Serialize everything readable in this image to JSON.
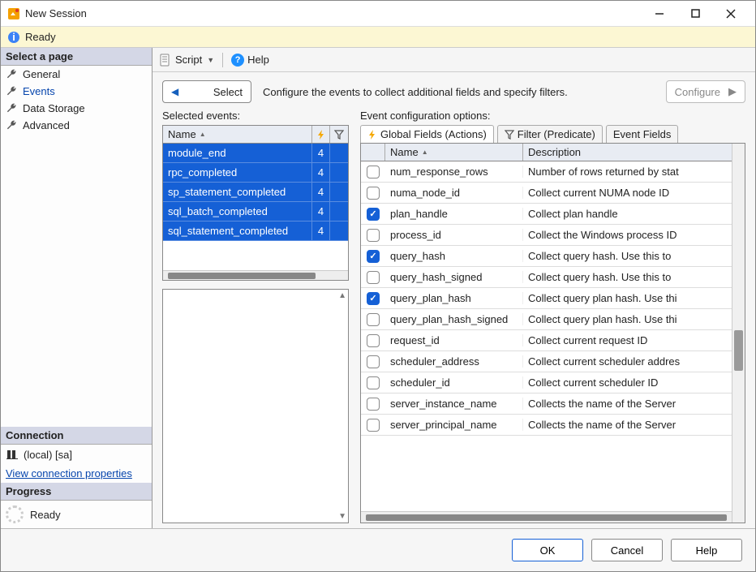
{
  "window": {
    "title": "New Session"
  },
  "ready_strip": {
    "text": "Ready"
  },
  "sidebar": {
    "select_page": "Select a page",
    "items": [
      {
        "label": "General"
      },
      {
        "label": "Events"
      },
      {
        "label": "Data Storage"
      },
      {
        "label": "Advanced"
      }
    ],
    "connection_head": "Connection",
    "connection_label": "(local) [sa]",
    "view_conn": "View connection properties",
    "progress_head": "Progress",
    "progress_status": "Ready"
  },
  "toolbar": {
    "script": "Script",
    "help": "Help"
  },
  "row1": {
    "select_label": "Select",
    "info": "Configure the events to collect additional fields and specify filters.",
    "configure_label": "Configure"
  },
  "left": {
    "label": "Selected events:",
    "head_name": "Name",
    "events": [
      {
        "name": "module_end",
        "count": "4"
      },
      {
        "name": "rpc_completed",
        "count": "4"
      },
      {
        "name": "sp_statement_completed",
        "count": "4"
      },
      {
        "name": "sql_batch_completed",
        "count": "4"
      },
      {
        "name": "sql_statement_completed",
        "count": "4"
      }
    ]
  },
  "right": {
    "label": "Event configuration options:",
    "tabs": {
      "global": "Global Fields (Actions)",
      "filter": "Filter (Predicate)",
      "eventfields": "Event Fields"
    },
    "head_name": "Name",
    "head_desc": "Description",
    "fields": [
      {
        "checked": false,
        "name": "num_response_rows",
        "desc": "Number of rows returned by stat"
      },
      {
        "checked": false,
        "name": "numa_node_id",
        "desc": "Collect current NUMA node ID"
      },
      {
        "checked": true,
        "name": "plan_handle",
        "desc": "Collect plan handle"
      },
      {
        "checked": false,
        "name": "process_id",
        "desc": "Collect the Windows process ID"
      },
      {
        "checked": true,
        "name": "query_hash",
        "desc": "Collect query hash. Use this to"
      },
      {
        "checked": false,
        "name": "query_hash_signed",
        "desc": "Collect query hash. Use this to"
      },
      {
        "checked": true,
        "name": "query_plan_hash",
        "desc": "Collect query plan hash. Use thi"
      },
      {
        "checked": false,
        "name": "query_plan_hash_signed",
        "desc": "Collect query plan hash. Use thi"
      },
      {
        "checked": false,
        "name": "request_id",
        "desc": "Collect current request ID"
      },
      {
        "checked": false,
        "name": "scheduler_address",
        "desc": "Collect current scheduler addres"
      },
      {
        "checked": false,
        "name": "scheduler_id",
        "desc": "Collect current scheduler ID"
      },
      {
        "checked": false,
        "name": "server_instance_name",
        "desc": "Collects the name of the Server"
      },
      {
        "checked": false,
        "name": "server_principal_name",
        "desc": "Collects the name of the Server"
      }
    ]
  },
  "footer": {
    "ok": "OK",
    "cancel": "Cancel",
    "help": "Help"
  }
}
